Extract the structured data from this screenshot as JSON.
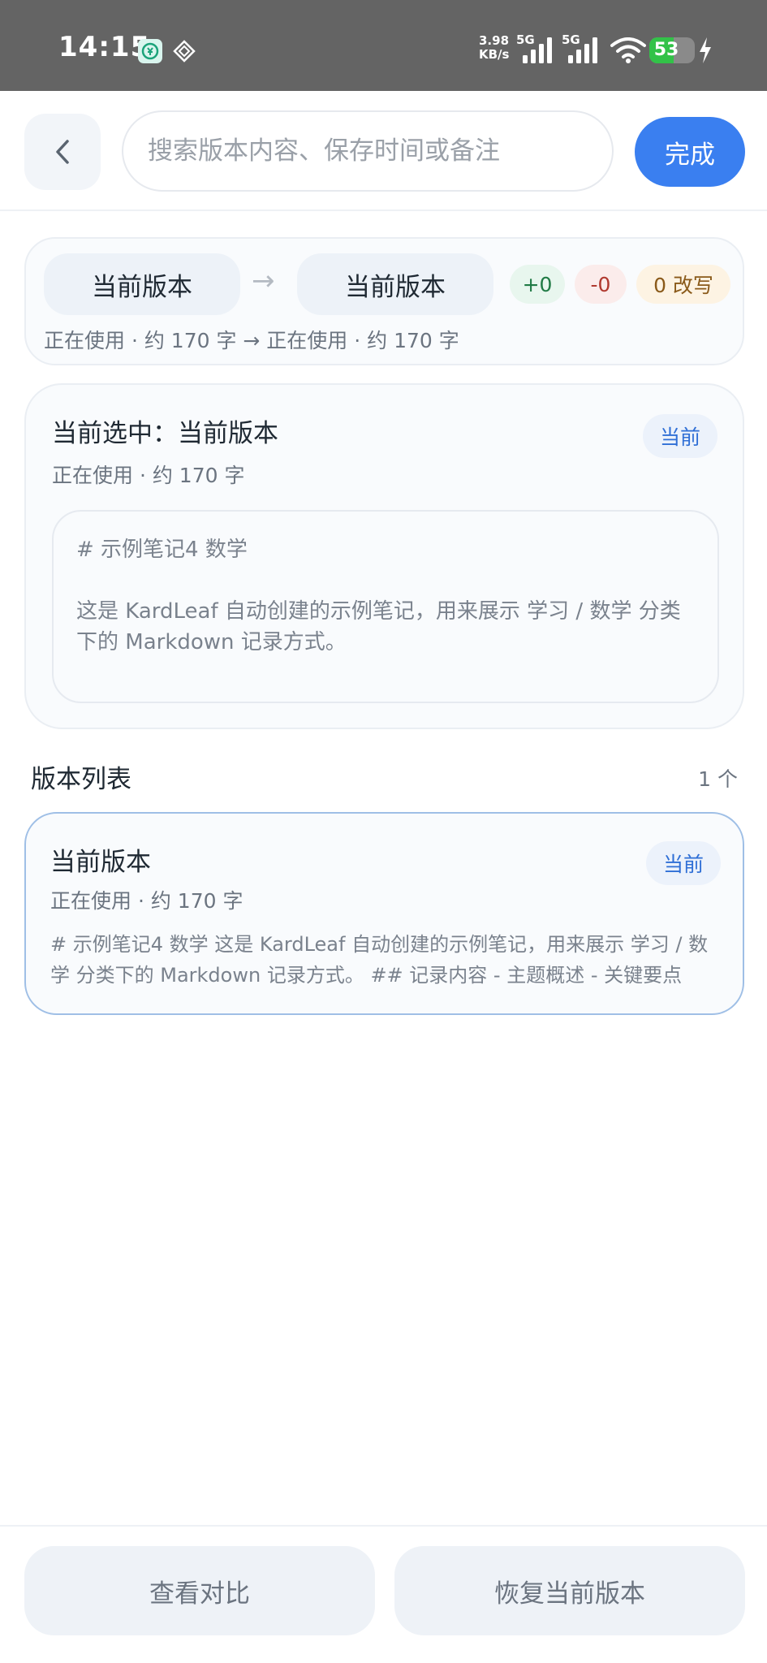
{
  "status_bar": {
    "time": "14:15",
    "net_speed_value": "3.98",
    "net_speed_unit": "KB/s",
    "signal1_label": "5G",
    "signal2_label": "5G",
    "battery": "53",
    "battery_level": 0.53
  },
  "header": {
    "back_symbol": "‹",
    "search_placeholder": "搜索版本内容、保存时间或备注",
    "done_label": "完成"
  },
  "compare": {
    "from_label": "当前版本",
    "to_label": "当前版本",
    "arrow": "→",
    "added": "+0",
    "removed": "-0",
    "modified": "0 改写",
    "summary": "正在使用 · 约 170 字 → 正在使用 · 约 170 字"
  },
  "selected": {
    "title": "当前选中：当前版本",
    "subtitle": "正在使用 · 约 170 字",
    "tag": "当前",
    "preview_heading": "# 示例笔记4 数学",
    "preview_body": "这是 KardLeaf 自动创建的示例笔记，用来展示 学习 / 数学 分类下的 Markdown 记录方式。"
  },
  "version_list": {
    "title": "版本列表",
    "count": "1 个",
    "items": [
      {
        "title": "当前版本",
        "subtitle": "正在使用 · 约 170 字",
        "tag": "当前",
        "preview": "# 示例笔记4 数学  这是 KardLeaf 自动创建的示例笔记，用来展示 学习 / 数学 分类下的 Markdown 记录方式。  ## 记录内容 - 主题概述 - 关键要点"
      }
    ]
  },
  "bottom": {
    "compare_label": "查看对比",
    "restore_label": "恢复当前版本"
  },
  "colors": {
    "accent": "#3a7ff0",
    "status_bar_bg": "#646464",
    "battery_green": "#32c248"
  }
}
